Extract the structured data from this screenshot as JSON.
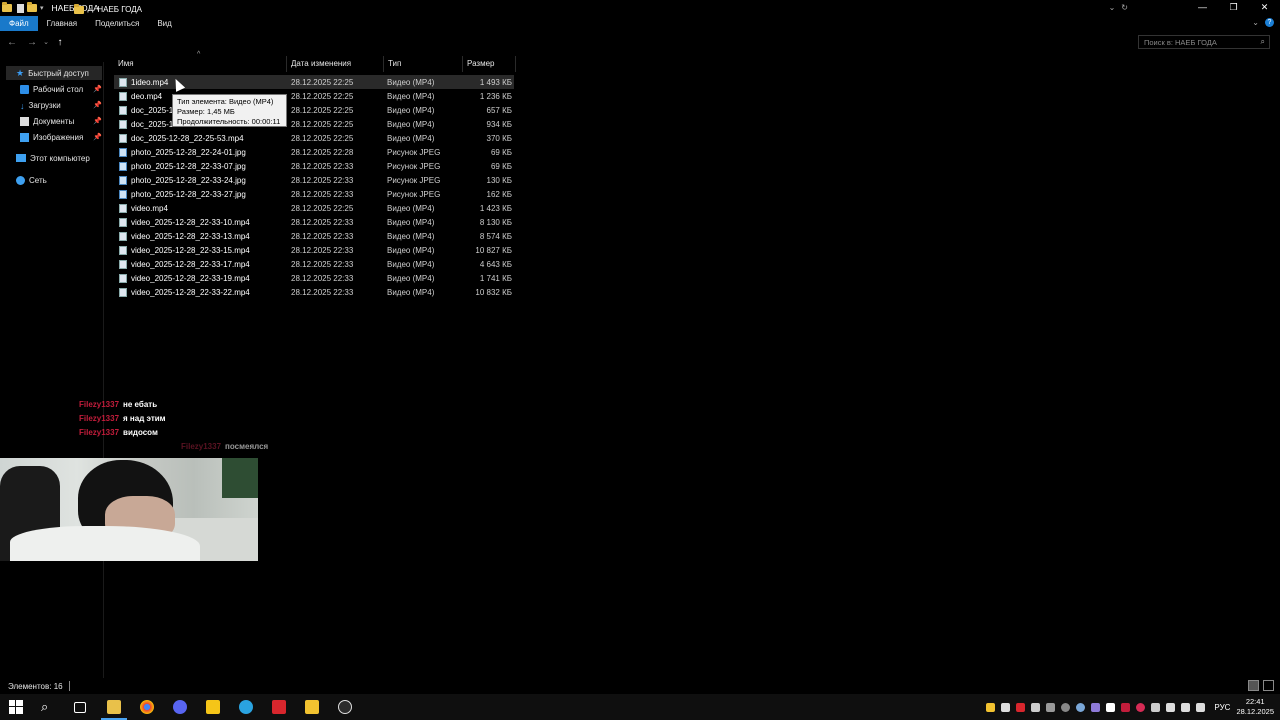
{
  "window": {
    "title": "НАЕБ ГОДА",
    "controls": [
      "—",
      "❐",
      "✕"
    ]
  },
  "ribbon": {
    "tabs": [
      "Файл",
      "Главная",
      "Поделиться",
      "Вид"
    ],
    "active_tab": "Файл",
    "accent": "#1979ca"
  },
  "address": {
    "path": "НАЕБ ГОДА",
    "search_placeholder": "Поиск в: НАЕБ ГОДА"
  },
  "navpane": {
    "quick_access": "Быстрый доступ",
    "items": [
      {
        "label": "Рабочий стол",
        "icon": "desktop-icon"
      },
      {
        "label": "Загрузки",
        "icon": "downloads-icon"
      },
      {
        "label": "Документы",
        "icon": "documents-icon"
      },
      {
        "label": "Изображения",
        "icon": "pictures-icon"
      }
    ],
    "this_pc": "Этот компьютер",
    "network": "Сеть"
  },
  "columns": {
    "name": "Имя",
    "date": "Дата изменения",
    "type": "Тип",
    "size": "Размер"
  },
  "files": [
    {
      "name": "1ideo.mp4",
      "date": "28.12.2025 22:25",
      "type": "Видео (MP4)",
      "size": "1 493 КБ",
      "kind": "video"
    },
    {
      "name": "deo.mp4",
      "date": "28.12.2025 22:25",
      "type": "Видео (MP4)",
      "size": "1 236 КБ",
      "kind": "video"
    },
    {
      "name": "doc_2025-1",
      "date": "28.12.2025 22:25",
      "type": "Видео (MP4)",
      "size": "657 КБ",
      "kind": "video"
    },
    {
      "name": "doc_2025-1",
      "date": "28.12.2025 22:25",
      "type": "Видео (MP4)",
      "size": "934 КБ",
      "kind": "video"
    },
    {
      "name": "doc_2025-12-28_22-25-53.mp4",
      "date": "28.12.2025 22:25",
      "type": "Видео (MP4)",
      "size": "370 КБ",
      "kind": "video"
    },
    {
      "name": "photo_2025-12-28_22-24-01.jpg",
      "date": "28.12.2025 22:28",
      "type": "Рисунок JPEG",
      "size": "69 КБ",
      "kind": "image"
    },
    {
      "name": "photo_2025-12-28_22-33-07.jpg",
      "date": "28.12.2025 22:33",
      "type": "Рисунок JPEG",
      "size": "69 КБ",
      "kind": "image"
    },
    {
      "name": "photo_2025-12-28_22-33-24.jpg",
      "date": "28.12.2025 22:33",
      "type": "Рисунок JPEG",
      "size": "130 КБ",
      "kind": "image"
    },
    {
      "name": "photo_2025-12-28_22-33-27.jpg",
      "date": "28.12.2025 22:33",
      "type": "Рисунок JPEG",
      "size": "162 КБ",
      "kind": "image"
    },
    {
      "name": "video.mp4",
      "date": "28.12.2025 22:25",
      "type": "Видео (MP4)",
      "size": "1 423 КБ",
      "kind": "video"
    },
    {
      "name": "video_2025-12-28_22-33-10.mp4",
      "date": "28.12.2025 22:33",
      "type": "Видео (MP4)",
      "size": "8 130 КБ",
      "kind": "video"
    },
    {
      "name": "video_2025-12-28_22-33-13.mp4",
      "date": "28.12.2025 22:33",
      "type": "Видео (MP4)",
      "size": "8 574 КБ",
      "kind": "video"
    },
    {
      "name": "video_2025-12-28_22-33-15.mp4",
      "date": "28.12.2025 22:33",
      "type": "Видео (MP4)",
      "size": "10 827 КБ",
      "kind": "video"
    },
    {
      "name": "video_2025-12-28_22-33-17.mp4",
      "date": "28.12.2025 22:33",
      "type": "Видео (MP4)",
      "size": "4 643 КБ",
      "kind": "video"
    },
    {
      "name": "video_2025-12-28_22-33-19.mp4",
      "date": "28.12.2025 22:33",
      "type": "Видео (MP4)",
      "size": "1 741 КБ",
      "kind": "video"
    },
    {
      "name": "video_2025-12-28_22-33-22.mp4",
      "date": "28.12.2025 22:33",
      "type": "Видео (MP4)",
      "size": "10 832 КБ",
      "kind": "video"
    }
  ],
  "tooltip": {
    "lines": [
      "Тип элемента: Видео (MP4)",
      "Размер: 1,45 МБ",
      "Продолжительность: 00:00:11"
    ]
  },
  "chat": [
    {
      "user": "Filezy1337",
      "msg": "не ебать"
    },
    {
      "user": "Filezy1337",
      "msg": "я над этим"
    },
    {
      "user": "Filezy1337",
      "msg": "видосом"
    },
    {
      "user": "Filezy1337",
      "msg": "посмеялся"
    }
  ],
  "status": {
    "count": "Элементов: 16"
  },
  "taskbar": {
    "language": "РУС",
    "time": "22:41",
    "date": "28.12.2025"
  }
}
